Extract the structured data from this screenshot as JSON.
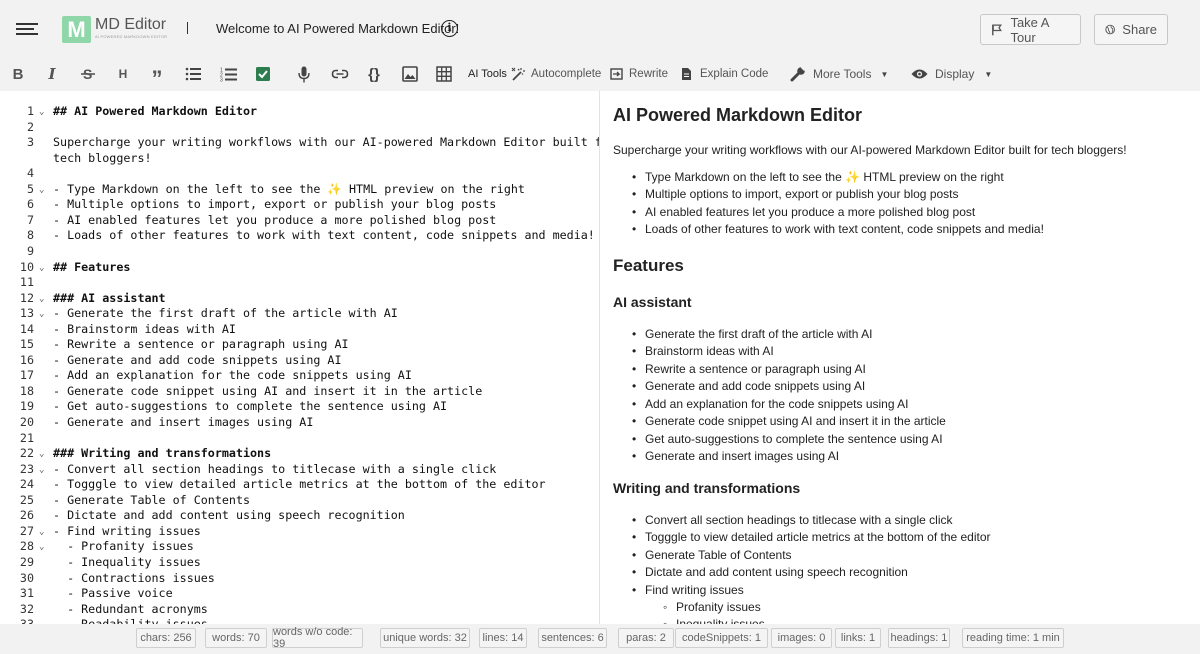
{
  "header": {
    "logo_letter": "M",
    "logo_title": "MD Editor",
    "logo_subtitle": "AI POWERED MARKDOWN EDITOR",
    "doc_title": "Welcome to AI Powered Markdown Editor!",
    "info_icon": "i",
    "tour_label": "Take A Tour",
    "share_label": "Share"
  },
  "toolbar": {
    "bold": "B",
    "italic": "I",
    "heading": "H",
    "quote": "”",
    "ai_tools_label": "AI Tools",
    "autocomplete": "Autocomplete",
    "rewrite": "Rewrite",
    "explain_code": "Explain Code",
    "more_tools": "More Tools",
    "display": "Display"
  },
  "editor": {
    "lines": [
      {
        "n": "1",
        "text": "## AI Powered Markdown Editor",
        "fold": true,
        "bold": true
      },
      {
        "n": "2",
        "text": ""
      },
      {
        "n": "3",
        "text": "Supercharge your writing workflows with our AI-powered Markdown Editor built for"
      },
      {
        "n": "",
        "text": "tech bloggers!"
      },
      {
        "n": "4",
        "text": ""
      },
      {
        "n": "5",
        "text": "- Type Markdown on the left to see the ✨ HTML preview on the right",
        "fold": true
      },
      {
        "n": "6",
        "text": "- Multiple options to import, export or publish your blog posts"
      },
      {
        "n": "7",
        "text": "- AI enabled features let you produce a more polished blog post"
      },
      {
        "n": "8",
        "text": "- Loads of other features to work with text content, code snippets and media!"
      },
      {
        "n": "9",
        "text": ""
      },
      {
        "n": "10",
        "text": "## Features",
        "fold": true,
        "bold": true
      },
      {
        "n": "11",
        "text": ""
      },
      {
        "n": "12",
        "text": "### AI assistant",
        "fold": true,
        "bold": true
      },
      {
        "n": "13",
        "text": "- Generate the first draft of the article with AI",
        "fold": true
      },
      {
        "n": "14",
        "text": "- Brainstorm ideas with AI"
      },
      {
        "n": "15",
        "text": "- Rewrite a sentence or paragraph using AI"
      },
      {
        "n": "16",
        "text": "- Generate and add code snippets using AI"
      },
      {
        "n": "17",
        "text": "- Add an explanation for the code snippets using AI"
      },
      {
        "n": "18",
        "text": "- Generate code snippet using AI and insert it in the article"
      },
      {
        "n": "19",
        "text": "- Get auto-suggestions to complete the sentence using AI"
      },
      {
        "n": "20",
        "text": "- Generate and insert images using AI"
      },
      {
        "n": "21",
        "text": ""
      },
      {
        "n": "22",
        "text": "### Writing and transformations",
        "fold": true,
        "bold": true
      },
      {
        "n": "23",
        "text": "- Convert all section headings to titlecase with a single click",
        "fold": true
      },
      {
        "n": "24",
        "text": "- Togggle to view detailed article metrics at the bottom of the editor"
      },
      {
        "n": "25",
        "text": "- Generate Table of Contents"
      },
      {
        "n": "26",
        "text": "- Dictate and add content using speech recognition"
      },
      {
        "n": "27",
        "text": "- Find writing issues",
        "fold": true
      },
      {
        "n": "28",
        "text": "  - Profanity issues",
        "fold": true
      },
      {
        "n": "29",
        "text": "  - Inequality issues"
      },
      {
        "n": "30",
        "text": "  - Contractions issues"
      },
      {
        "n": "31",
        "text": "  - Passive voice"
      },
      {
        "n": "32",
        "text": "  - Redundant acronyms"
      },
      {
        "n": "33",
        "text": "  - Readability issues"
      }
    ]
  },
  "preview": {
    "h1": "AI Powered Markdown Editor",
    "intro": "Supercharge your writing workflows with our AI-powered Markdown Editor built for tech bloggers!",
    "intro_list": [
      "Type Markdown on the left to see the ✨ HTML preview on the right",
      "Multiple options to import, export or publish your blog posts",
      "AI enabled features let you produce a more polished blog post",
      "Loads of other features to work with text content, code snippets and media!"
    ],
    "features_heading": "Features",
    "ai_heading": "AI assistant",
    "ai_list": [
      "Generate the first draft of the article with AI",
      "Brainstorm ideas with AI",
      "Rewrite a sentence or paragraph using AI",
      "Generate and add code snippets using AI",
      "Add an explanation for the code snippets using AI",
      "Generate code snippet using AI and insert it in the article",
      "Get auto-suggestions to complete the sentence using AI",
      "Generate and insert images using AI"
    ],
    "writing_heading": "Writing and transformations",
    "writing_list": [
      "Convert all section headings to titlecase with a single click",
      "Togggle to view detailed article metrics at the bottom of the editor",
      "Generate Table of Contents",
      "Dictate and add content using speech recognition",
      "Find writing issues"
    ],
    "writing_sublist": [
      "Profanity issues",
      "Inequality issues"
    ]
  },
  "status": [
    "chars: 256",
    "words: 70",
    "words w/o code: 39",
    "unique words: 32",
    "lines: 14",
    "sentences: 6",
    "paras: 2",
    "codeSnippets: 1",
    "images: 0",
    "links: 1",
    "headings: 1",
    "reading time: 1 min"
  ],
  "colors": {
    "logo_green": "#8fd6a8",
    "toolbar_check": "#2e7d4f"
  }
}
